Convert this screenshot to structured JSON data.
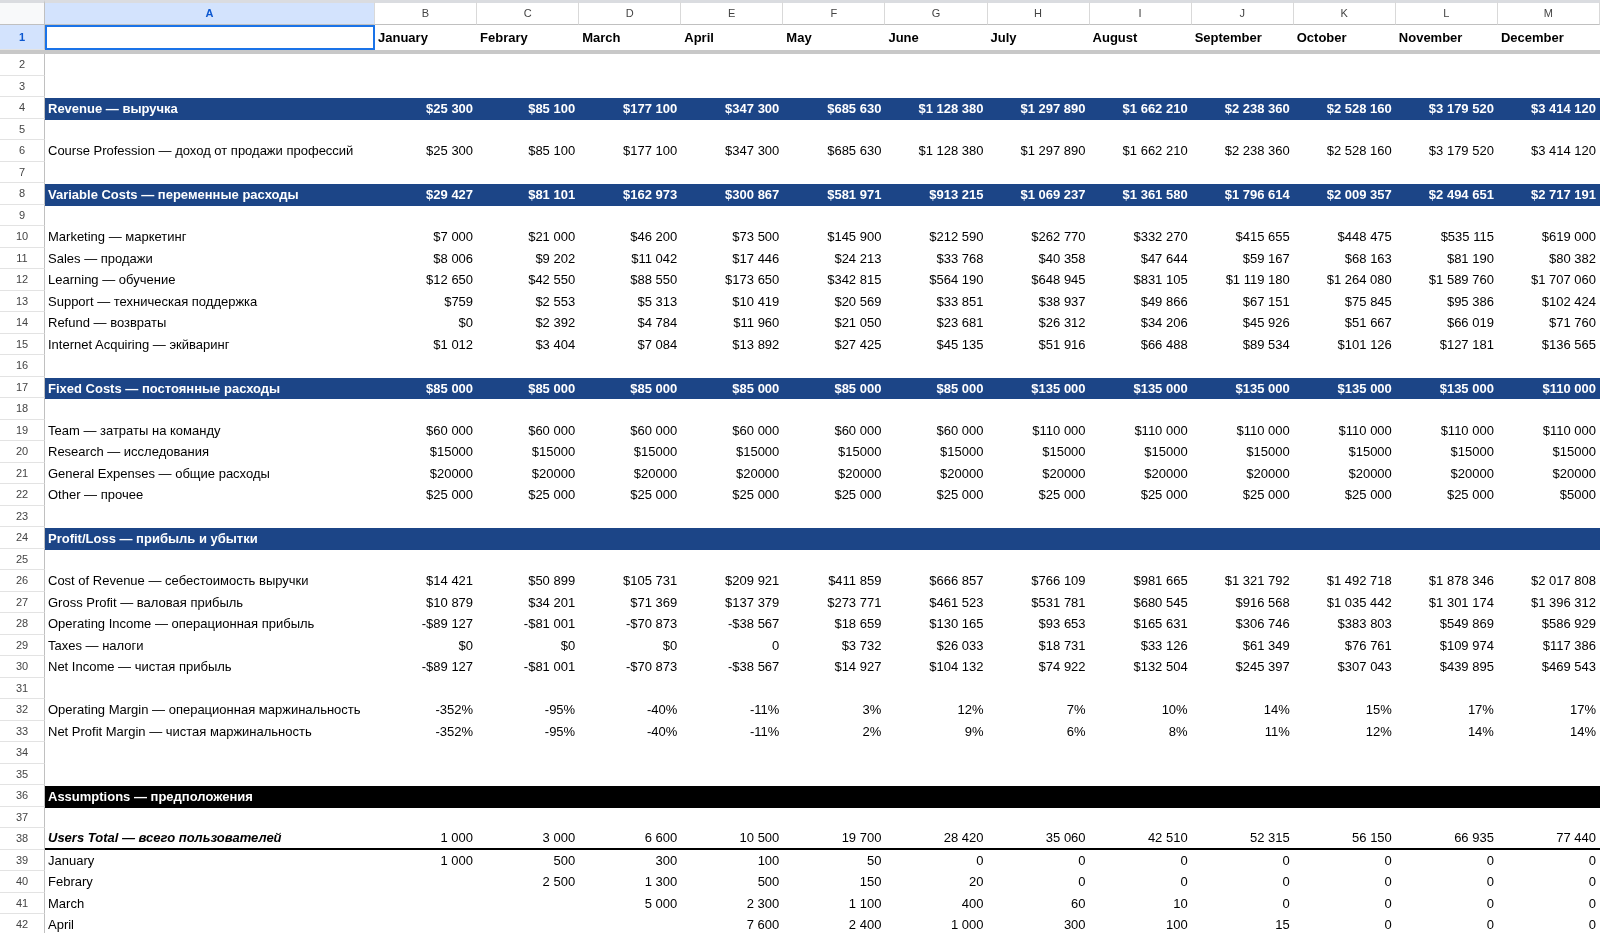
{
  "columns": [
    {
      "letter": "A",
      "selected": true
    },
    {
      "letter": "B",
      "selected": false
    },
    {
      "letter": "C",
      "selected": false
    },
    {
      "letter": "D",
      "selected": false
    },
    {
      "letter": "E",
      "selected": false
    },
    {
      "letter": "F",
      "selected": false
    },
    {
      "letter": "G",
      "selected": false
    },
    {
      "letter": "H",
      "selected": false
    },
    {
      "letter": "I",
      "selected": false
    },
    {
      "letter": "J",
      "selected": false
    },
    {
      "letter": "K",
      "selected": false
    },
    {
      "letter": "L",
      "selected": false
    },
    {
      "letter": "M",
      "selected": false
    }
  ],
  "rows": [
    {
      "number": "1",
      "kind": "header",
      "selected": true,
      "values": [
        "January",
        "Febrary",
        "March",
        "April",
        "May",
        "June",
        "July",
        "August",
        "September",
        "October",
        "November",
        "December"
      ]
    },
    {
      "number": "2",
      "kind": "blank",
      "selected": false
    },
    {
      "number": "3",
      "kind": "blank",
      "selected": false
    },
    {
      "number": "4",
      "kind": "section",
      "selected": false,
      "color": "#1c4587",
      "label": "Revenue — выручка",
      "values": [
        "$25 300",
        "$85 100",
        "$177 100",
        "$347 300",
        "$685 630",
        "$1 128 380",
        "$1 297 890",
        "$1 662 210",
        "$2 238 360",
        "$2 528 160",
        "$3 179 520",
        "$3 414 120"
      ]
    },
    {
      "number": "5",
      "kind": "blank",
      "selected": false
    },
    {
      "number": "6",
      "kind": "item",
      "selected": false,
      "label": "Course Profession — доход от продажи профессий",
      "values": [
        "$25 300",
        "$85 100",
        "$177 100",
        "$347 300",
        "$685 630",
        "$1 128 380",
        "$1 297 890",
        "$1 662 210",
        "$2 238 360",
        "$2 528 160",
        "$3 179 520",
        "$3 414 120"
      ]
    },
    {
      "number": "7",
      "kind": "blank",
      "selected": false
    },
    {
      "number": "8",
      "kind": "section",
      "selected": false,
      "color": "#1c4587",
      "label": "Variable Costs — переменные расходы",
      "values": [
        "$29 427",
        "$81 101",
        "$162 973",
        "$300 867",
        "$581 971",
        "$913 215",
        "$1 069 237",
        "$1 361 580",
        "$1 796 614",
        "$2 009 357",
        "$2 494 651",
        "$2 717 191"
      ]
    },
    {
      "number": "9",
      "kind": "blank",
      "selected": false
    },
    {
      "number": "10",
      "kind": "item",
      "selected": false,
      "label": "Marketing — маркетинг",
      "values": [
        "$7 000",
        "$21 000",
        "$46 200",
        "$73 500",
        "$145 900",
        "$212 590",
        "$262 770",
        "$332 270",
        "$415 655",
        "$448 475",
        "$535 115",
        "$619 000"
      ]
    },
    {
      "number": "11",
      "kind": "item",
      "selected": false,
      "label": "Sales — продажи",
      "values": [
        "$8 006",
        "$9 202",
        "$11 042",
        "$17 446",
        "$24 213",
        "$33 768",
        "$40 358",
        "$47 644",
        "$59 167",
        "$68 163",
        "$81 190",
        "$80 382"
      ]
    },
    {
      "number": "12",
      "kind": "item",
      "selected": false,
      "label": "Learning — обучение",
      "values": [
        "$12 650",
        "$42 550",
        "$88 550",
        "$173 650",
        "$342 815",
        "$564 190",
        "$648 945",
        "$831 105",
        "$1 119 180",
        "$1 264 080",
        "$1 589 760",
        "$1 707 060"
      ]
    },
    {
      "number": "13",
      "kind": "item",
      "selected": false,
      "label": "Support — техническая поддержка",
      "values": [
        "$759",
        "$2 553",
        "$5 313",
        "$10 419",
        "$20 569",
        "$33 851",
        "$38 937",
        "$49 866",
        "$67 151",
        "$75 845",
        "$95 386",
        "$102 424"
      ]
    },
    {
      "number": "14",
      "kind": "item",
      "selected": false,
      "label": "Refund — возвраты",
      "values": [
        "$0",
        "$2 392",
        "$4 784",
        "$11 960",
        "$21 050",
        "$23 681",
        "$26 312",
        "$34 206",
        "$45 926",
        "$51 667",
        "$66 019",
        "$71 760"
      ]
    },
    {
      "number": "15",
      "kind": "item",
      "selected": false,
      "label": "Internet Acquiring — экйваринг",
      "values": [
        "$1 012",
        "$3 404",
        "$7 084",
        "$13 892",
        "$27 425",
        "$45 135",
        "$51 916",
        "$66 488",
        "$89 534",
        "$101 126",
        "$127 181",
        "$136 565"
      ]
    },
    {
      "number": "16",
      "kind": "blank",
      "selected": false
    },
    {
      "number": "17",
      "kind": "section",
      "selected": false,
      "color": "#1c4587",
      "label": "Fixed Costs — постоянные расходы",
      "values": [
        "$85 000",
        "$85 000",
        "$85 000",
        "$85 000",
        "$85 000",
        "$85 000",
        "$135 000",
        "$135 000",
        "$135 000",
        "$135 000",
        "$135 000",
        "$110 000"
      ]
    },
    {
      "number": "18",
      "kind": "blank",
      "selected": false
    },
    {
      "number": "19",
      "kind": "item",
      "selected": false,
      "label": "Team — затраты на команду",
      "values": [
        "$60 000",
        "$60 000",
        "$60 000",
        "$60 000",
        "$60 000",
        "$60 000",
        "$110 000",
        "$110 000",
        "$110 000",
        "$110 000",
        "$110 000",
        "$110 000"
      ]
    },
    {
      "number": "20",
      "kind": "item",
      "selected": false,
      "label": "Research — исследования",
      "values": [
        "$15000",
        "$15000",
        "$15000",
        "$15000",
        "$15000",
        "$15000",
        "$15000",
        "$15000",
        "$15000",
        "$15000",
        "$15000",
        "$15000"
      ]
    },
    {
      "number": "21",
      "kind": "item",
      "selected": false,
      "label": "General Expenses — общие расходы",
      "values": [
        "$20000",
        "$20000",
        "$20000",
        "$20000",
        "$20000",
        "$20000",
        "$20000",
        "$20000",
        "$20000",
        "$20000",
        "$20000",
        "$20000"
      ]
    },
    {
      "number": "22",
      "kind": "item",
      "selected": false,
      "label": "Other — прочее",
      "values": [
        "$25 000",
        "$25 000",
        "$25 000",
        "$25 000",
        "$25 000",
        "$25 000",
        "$25 000",
        "$25 000",
        "$25 000",
        "$25 000",
        "$25 000",
        "$5000"
      ]
    },
    {
      "number": "23",
      "kind": "blank",
      "selected": false
    },
    {
      "number": "24",
      "kind": "section",
      "selected": false,
      "color": "#1c4587",
      "label": "Profit/Loss — прибыль и убытки"
    },
    {
      "number": "25",
      "kind": "blank",
      "selected": false
    },
    {
      "number": "26",
      "kind": "item",
      "selected": false,
      "label": "Cost of Revenue — себестоимость выручки",
      "values": [
        "$14 421",
        "$50 899",
        "$105 731",
        "$209 921",
        "$411 859",
        "$666 857",
        "$766 109",
        "$981 665",
        "$1 321 792",
        "$1 492 718",
        "$1 878 346",
        "$2 017 808"
      ]
    },
    {
      "number": "27",
      "kind": "item",
      "selected": false,
      "label": "Gross Profit — валовая прибыль",
      "values": [
        "$10 879",
        "$34 201",
        "$71 369",
        "$137 379",
        "$273 771",
        "$461 523",
        "$531 781",
        "$680 545",
        "$916 568",
        "$1 035 442",
        "$1 301 174",
        "$1 396 312"
      ]
    },
    {
      "number": "28",
      "kind": "item",
      "selected": false,
      "label": "Operating Income — операционная прибыль",
      "values": [
        "-$89 127",
        "-$81 001",
        "-$70 873",
        "-$38 567",
        "$18 659",
        "$130 165",
        "$93 653",
        "$165 631",
        "$306 746",
        "$383 803",
        "$549 869",
        "$586 929"
      ]
    },
    {
      "number": "29",
      "kind": "item",
      "selected": false,
      "label": "Taxes — налоги",
      "values": [
        "$0",
        "$0",
        "$0",
        "0",
        "$3 732",
        "$26 033",
        "$18 731",
        "$33 126",
        "$61 349",
        "$76 761",
        "$109 974",
        "$117 386"
      ]
    },
    {
      "number": "30",
      "kind": "item",
      "selected": false,
      "label": "Net Income — чистая прибыль",
      "values": [
        "-$89 127",
        "-$81 001",
        "-$70 873",
        "-$38 567",
        "$14 927",
        "$104 132",
        "$74 922",
        "$132 504",
        "$245 397",
        "$307 043",
        "$439 895",
        "$469 543"
      ]
    },
    {
      "number": "31",
      "kind": "blank",
      "selected": false
    },
    {
      "number": "32",
      "kind": "item",
      "selected": false,
      "label": "Operating Margin — операционная маржинальность",
      "values": [
        "-352%",
        "-95%",
        "-40%",
        "-11%",
        "3%",
        "12%",
        "7%",
        "10%",
        "14%",
        "15%",
        "17%",
        "17%"
      ]
    },
    {
      "number": "33",
      "kind": "item",
      "selected": false,
      "label": "Net Profit Margin — чистая маржинальность",
      "values": [
        "-352%",
        "-95%",
        "-40%",
        "-11%",
        "2%",
        "9%",
        "6%",
        "8%",
        "11%",
        "12%",
        "14%",
        "14%"
      ]
    },
    {
      "number": "34",
      "kind": "blank",
      "selected": false
    },
    {
      "number": "35",
      "kind": "blank",
      "selected": false
    },
    {
      "number": "36",
      "kind": "section",
      "selected": false,
      "color": "#000000",
      "label": "Assumptions — предположения"
    },
    {
      "number": "37",
      "kind": "blank",
      "selected": false
    },
    {
      "number": "38",
      "kind": "total",
      "selected": false,
      "label": "Users Total — всего пользователей",
      "values": [
        "1 000",
        "3 000",
        "6 600",
        "10 500",
        "19 700",
        "28 420",
        "35 060",
        "42 510",
        "52 315",
        "56 150",
        "66 935",
        "77 440"
      ]
    },
    {
      "number": "39",
      "kind": "item",
      "selected": false,
      "label": "January",
      "values": [
        "1 000",
        "500",
        "300",
        "100",
        "50",
        "0",
        "0",
        "0",
        "0",
        "0",
        "0",
        "0"
      ]
    },
    {
      "number": "40",
      "kind": "item",
      "selected": false,
      "label": "Febrary",
      "cells": {
        "C": "2 500",
        "D": "1 300",
        "E": "500",
        "F": "150",
        "G": "20",
        "H": "0",
        "I": "0",
        "J": "0",
        "K": "0",
        "L": "0",
        "M": "0"
      }
    },
    {
      "number": "41",
      "kind": "item",
      "selected": false,
      "label": "March",
      "cells": {
        "D": "5 000",
        "E": "2 300",
        "F": "1 100",
        "G": "400",
        "H": "60",
        "I": "10",
        "J": "0",
        "K": "0",
        "L": "0",
        "M": "0"
      }
    },
    {
      "number": "42",
      "kind": "item",
      "selected": false,
      "label": "April",
      "cells": {
        "E": "7 600",
        "F": "2 400",
        "G": "1 000",
        "H": "300",
        "I": "100",
        "J": "15",
        "K": "0",
        "L": "0",
        "M": "0"
      }
    }
  ]
}
